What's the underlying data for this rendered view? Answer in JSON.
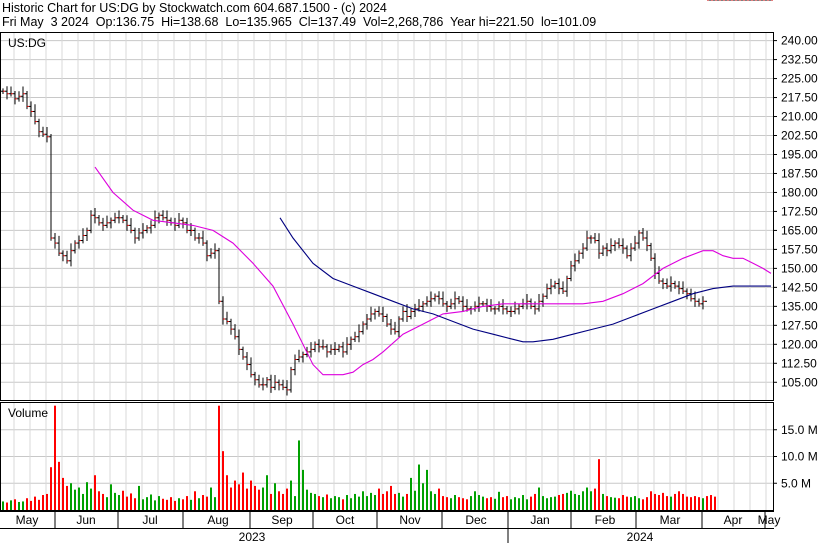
{
  "header": {
    "line1": "Historic Chart for US:DG by Stockwatch.com 604.687.1500 - (c) 2024",
    "line2": "Fri May  3 2024  Op:136.75  Hi=138.68  Lo=135.965  Cl=137.49  Vol=2,268,786  Year hi=221.50  lo=101.09"
  },
  "chart_data": {
    "type": "line",
    "symbol_label": "US:DG",
    "volume_label": "Volume",
    "price_ylim": [
      98.0,
      243.0
    ],
    "price_ticks": [
      "240.00",
      "232.50",
      "225.00",
      "217.50",
      "210.00",
      "202.50",
      "195.00",
      "187.50",
      "180.00",
      "172.50",
      "165.00",
      "157.50",
      "150.00",
      "142.50",
      "135.00",
      "127.50",
      "120.00",
      "112.50",
      "105.00"
    ],
    "volume_ylim": [
      0,
      20.0
    ],
    "volume_ticks": [
      "15.0 M",
      "10.0 M",
      "5.0 M"
    ],
    "month_labels": [
      "May",
      "Jun",
      "Jul",
      "Aug",
      "Sep",
      "Oct",
      "Nov",
      "Dec",
      "Jan",
      "Feb",
      "Mar",
      "Apr",
      "May"
    ],
    "year_labels": [
      "2023",
      "2024"
    ],
    "price_series": {
      "name": "price",
      "x_index": [
        0,
        4,
        8,
        12,
        16,
        20,
        24,
        28,
        32,
        36,
        40,
        44,
        48,
        52,
        56,
        60,
        64,
        68,
        72,
        76,
        80,
        84,
        88,
        92,
        96,
        100,
        104,
        108,
        112,
        116,
        120,
        124,
        128,
        132,
        136,
        140,
        144,
        148,
        152,
        156,
        160,
        164,
        168,
        172,
        176,
        180,
        184,
        188,
        192,
        196,
        200,
        204,
        208,
        212,
        216,
        220,
        224,
        228,
        232,
        236,
        240,
        244,
        248,
        252,
        256,
        260,
        264,
        268,
        272,
        276,
        280,
        284,
        288,
        292,
        296,
        300,
        304,
        308,
        312,
        316,
        320,
        324,
        328,
        332,
        336,
        340,
        344,
        348,
        352,
        356,
        360,
        364,
        368,
        372,
        376,
        380,
        384,
        388,
        392,
        396,
        400,
        404,
        408,
        412,
        416,
        420,
        424,
        428,
        432,
        436,
        440,
        444,
        448,
        452,
        456,
        460,
        464,
        468,
        472,
        476,
        480,
        484,
        488,
        492,
        496,
        500,
        504,
        508,
        512,
        516,
        520,
        524,
        528,
        532,
        536,
        540,
        544,
        548,
        552,
        556,
        560,
        564,
        568,
        572,
        576,
        580,
        584,
        588,
        592,
        596,
        600,
        604,
        608,
        612,
        616,
        620,
        624,
        628,
        632,
        636,
        640,
        644,
        648,
        652,
        656,
        660,
        664,
        668,
        672,
        676,
        680,
        684,
        688,
        692,
        696,
        700,
        704,
        708,
        712,
        716,
        720,
        724,
        728,
        732,
        736,
        740,
        744,
        748,
        752,
        756,
        760,
        764,
        768
      ],
      "close": [
        220,
        219,
        219,
        217,
        218,
        219,
        214,
        212,
        208,
        204,
        203,
        202,
        162,
        160,
        156,
        155,
        153,
        157,
        160,
        161,
        163,
        165,
        171,
        170,
        168,
        167,
        168,
        169,
        170,
        170,
        169,
        167,
        165,
        162,
        164,
        165,
        166,
        167,
        170,
        171,
        170,
        169,
        168,
        167,
        169,
        168,
        165,
        165,
        162,
        162,
        160,
        155,
        156,
        157,
        137,
        130,
        129,
        126,
        123,
        118,
        115,
        112,
        108,
        106,
        104,
        104,
        106,
        103,
        105,
        104,
        103,
        102,
        110,
        114,
        115,
        116,
        117,
        118,
        120,
        119,
        119,
        117,
        118,
        118,
        119,
        117,
        120,
        122,
        123,
        125,
        128,
        130,
        132,
        133,
        132,
        131,
        128,
        126,
        125,
        130,
        133,
        131,
        133,
        134,
        135,
        136,
        137,
        138,
        139,
        138,
        136,
        135,
        136,
        138,
        137,
        135,
        134,
        134,
        135,
        136,
        136,
        135,
        134,
        134,
        135,
        134,
        133,
        133,
        134,
        135,
        136,
        137,
        135,
        134,
        137,
        139,
        142,
        143,
        144,
        142,
        141,
        146,
        151,
        153,
        156,
        158,
        162,
        162,
        161,
        156,
        158,
        157,
        159,
        160,
        159,
        158,
        155,
        158,
        160,
        164,
        162,
        159,
        154,
        148,
        145,
        144,
        143,
        144,
        143,
        142,
        141,
        140,
        138,
        137,
        136,
        137
      ],
      "high_off": 2.2,
      "low_off": 2.2
    },
    "ma_short": {
      "name": "moving average (short)",
      "color": "#dd00dd",
      "x_index": [
        92,
        110,
        130,
        150,
        170,
        190,
        210,
        230,
        250,
        270,
        290,
        310,
        320,
        340,
        350,
        360,
        370,
        380,
        400,
        420,
        440,
        460,
        480,
        500,
        520,
        540,
        560,
        580,
        600,
        620,
        640,
        660,
        680,
        700,
        710,
        720,
        730,
        740,
        750,
        760,
        768
      ],
      "values": [
        190,
        180,
        173,
        169,
        168,
        167,
        165,
        160,
        152,
        143,
        128,
        112,
        108,
        108,
        109,
        112,
        114,
        117,
        124,
        128,
        132,
        133,
        135,
        136,
        136,
        136,
        136,
        136,
        137,
        140,
        144,
        150,
        154,
        157,
        157,
        155,
        154,
        154,
        152,
        150,
        148
      ]
    },
    "ma_long": {
      "name": "moving average (long)",
      "color": "#000080",
      "x_index": [
        277,
        290,
        310,
        330,
        350,
        370,
        390,
        410,
        430,
        450,
        470,
        490,
        510,
        520,
        530,
        550,
        570,
        590,
        610,
        630,
        650,
        670,
        690,
        710,
        730,
        750,
        768
      ],
      "values": [
        170,
        162,
        152,
        146,
        143,
        140,
        137,
        134,
        132,
        129,
        126,
        124,
        122,
        121,
        121,
        122,
        124,
        126,
        128,
        131,
        134,
        137,
        140,
        142,
        143,
        143,
        143
      ]
    },
    "volume_series": {
      "name": "volume",
      "x_index": [
        0,
        4,
        8,
        12,
        16,
        20,
        24,
        28,
        32,
        36,
        40,
        44,
        48,
        52,
        56,
        60,
        64,
        68,
        72,
        76,
        80,
        84,
        88,
        92,
        96,
        100,
        104,
        108,
        112,
        116,
        120,
        124,
        128,
        132,
        136,
        140,
        144,
        148,
        152,
        156,
        160,
        164,
        168,
        172,
        176,
        180,
        184,
        188,
        192,
        196,
        200,
        204,
        208,
        212,
        216,
        220,
        224,
        228,
        232,
        236,
        240,
        244,
        248,
        252,
        256,
        260,
        264,
        268,
        272,
        276,
        280,
        284,
        288,
        292,
        296,
        300,
        304,
        308,
        312,
        316,
        320,
        324,
        328,
        332,
        336,
        340,
        344,
        348,
        352,
        356,
        360,
        364,
        368,
        372,
        376,
        380,
        384,
        388,
        392,
        396,
        400,
        404,
        408,
        412,
        416,
        420,
        424,
        428,
        432,
        436,
        440,
        444,
        448,
        452,
        456,
        460,
        464,
        468,
        472,
        476,
        480,
        484,
        488,
        492,
        496,
        500,
        504,
        508,
        512,
        516,
        520,
        524,
        528,
        532,
        536,
        540,
        544,
        548,
        552,
        556,
        560,
        564,
        568,
        572,
        576,
        580,
        584,
        588,
        592,
        596,
        600,
        604,
        608,
        612,
        616,
        620,
        624,
        628,
        632,
        636,
        640,
        644,
        648,
        652,
        656,
        660,
        664,
        668,
        672,
        676,
        680,
        684,
        688,
        692,
        696,
        700,
        704,
        708,
        712,
        716,
        720,
        724,
        728,
        732,
        736,
        740,
        744,
        748,
        752,
        756,
        760,
        764,
        768
      ],
      "values": [
        1.6,
        1.4,
        1.8,
        2.0,
        1.5,
        1.6,
        2.2,
        1.7,
        2.5,
        1.9,
        2.8,
        3.0,
        8.0,
        19.5,
        9.0,
        6.0,
        4.5,
        5.0,
        3.8,
        4.2,
        3.0,
        5.2,
        4.0,
        6.5,
        3.5,
        3.0,
        2.4,
        4.8,
        3.2,
        2.8,
        3.6,
        2.5,
        3.1,
        2.2,
        4.5,
        2.0,
        2.4,
        2.9,
        1.8,
        2.6,
        2.1,
        1.9,
        2.4,
        1.7,
        2.2,
        2.0,
        2.6,
        1.9,
        3.5,
        2.2,
        2.8,
        2.5,
        4.2,
        2.4,
        19.5,
        11.0,
        6.5,
        4.2,
        5.5,
        4.8,
        7.0,
        4.0,
        5.5,
        4.5,
        3.8,
        4.2,
        6.5,
        3.0,
        5.0,
        3.5,
        3.0,
        4.0,
        5.5,
        2.6,
        13.0,
        7.5,
        3.8,
        3.2,
        3.0,
        2.6,
        2.4,
        2.9,
        2.2,
        2.6,
        2.4,
        2.0,
        2.8,
        2.2,
        3.0,
        2.5,
        3.5,
        2.6,
        3.2,
        2.8,
        4.0,
        3.0,
        3.5,
        4.5,
        3.0,
        3.2,
        2.5,
        3.0,
        6.0,
        3.6,
        8.5,
        5.0,
        7.5,
        3.5,
        3.0,
        4.0,
        2.6,
        2.4,
        2.2,
        2.8,
        2.4,
        2.2,
        2.0,
        2.6,
        3.5,
        2.8,
        2.5,
        2.2,
        2.4,
        2.1,
        3.4,
        2.4,
        2.6,
        2.0,
        2.4,
        2.2,
        2.8,
        2.0,
        2.5,
        3.0,
        4.2,
        2.6,
        2.2,
        2.4,
        2.5,
        2.8,
        3.0,
        3.2,
        3.6,
        3.0,
        2.8,
        3.5,
        4.2,
        3.5,
        4.0,
        9.5,
        3.0,
        2.6,
        2.4,
        2.3,
        2.2,
        2.8,
        2.5,
        2.4,
        2.6,
        2.2,
        2.0,
        2.4,
        3.5,
        3.0,
        2.8,
        3.2,
        2.6,
        2.5,
        3.0,
        3.5,
        3.0,
        2.5,
        2.4,
        2.6,
        2.4,
        2.2,
        2.6,
        2.8,
        2.5
      ],
      "colors": [
        "#00a000",
        "#ff0000"
      ]
    }
  }
}
